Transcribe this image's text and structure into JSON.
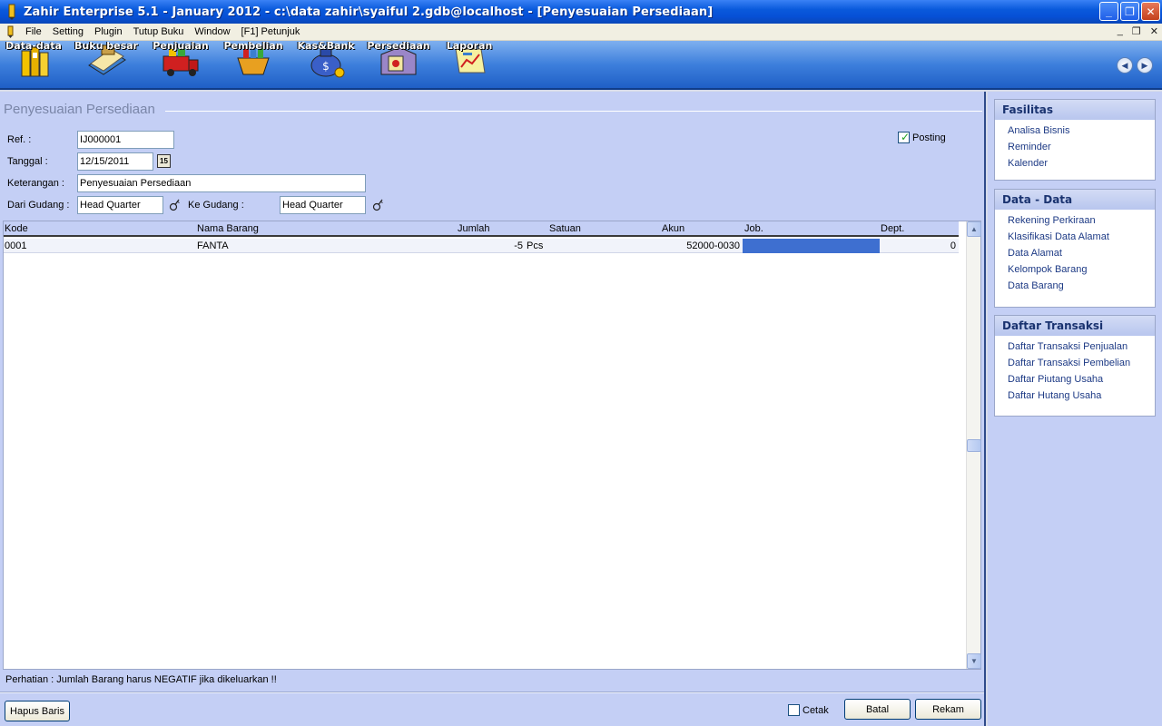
{
  "window": {
    "title": "Zahir Enterprise 5.1 - January 2012 - c:\\data zahir\\syaiful 2.gdb@localhost - [Penyesuaian Persediaan]",
    "min_glyph": "_",
    "max_glyph": "❐",
    "close_glyph": "✕"
  },
  "menu": {
    "items": [
      "File",
      "Setting",
      "Plugin",
      "Tutup Buku",
      "Window",
      "[F1] Petunjuk"
    ],
    "mdi_min": "_",
    "mdi_restore": "❐",
    "mdi_close": "✕"
  },
  "toolbar": {
    "buttons": [
      {
        "label": "Data-data",
        "icon": "binders-icon"
      },
      {
        "label": "Buku besar",
        "icon": "ledger-book-icon"
      },
      {
        "label": "Penjualan",
        "icon": "sales-truck-icon"
      },
      {
        "label": "Pembelian",
        "icon": "purchase-basket-icon"
      },
      {
        "label": "Kas&Bank",
        "icon": "money-bag-icon"
      },
      {
        "label": "Persediaan",
        "icon": "warehouse-box-icon"
      },
      {
        "label": "Laporan",
        "icon": "report-scroll-icon"
      }
    ],
    "nav_prev": "◀",
    "nav_next": "▶"
  },
  "form": {
    "title": "Penyesuaian Persediaan",
    "ref_label": "Ref. :",
    "ref_value": "IJ000001",
    "tanggal_label": "Tanggal :",
    "tanggal_value": "12/15/2011",
    "cal_label": "15",
    "keterangan_label": "Keterangan :",
    "keterangan_value": "Penyesuaian Persediaan",
    "dari_label": "Dari Gudang :",
    "dari_value": "Head Quarter",
    "ke_label": "Ke Gudang :",
    "ke_value": "Head Quarter",
    "posting_label": "Posting",
    "posting_checked": true
  },
  "grid": {
    "columns": [
      "Kode",
      "Nama Barang",
      "Jumlah",
      "Satuan",
      "Akun",
      "Job.",
      "Dept."
    ],
    "rows": [
      {
        "kode": "0001",
        "nama": "FANTA",
        "jumlah": "-5",
        "satuan": "Pcs",
        "akun": "52000-0030",
        "job": "",
        "dept": "0"
      }
    ],
    "scroll_up": "▲",
    "scroll_down": "▼"
  },
  "notice": "Perhatian : Jumlah Barang harus NEGATIF jika dikeluarkan !!",
  "actions": {
    "hapus_baris": "Hapus Baris",
    "cetak": "Cetak",
    "batal": "Batal",
    "rekam": "Rekam"
  },
  "sidebar": {
    "fasilitas": {
      "title": "Fasilitas",
      "items": [
        "Analisa Bisnis",
        "Reminder",
        "Kalender"
      ]
    },
    "data": {
      "title": "Data - Data",
      "items": [
        "Rekening Perkiraan",
        "Klasifikasi Data Alamat",
        "Data Alamat",
        "Kelompok Barang",
        "Data Barang"
      ]
    },
    "transaksi": {
      "title": "Daftar Transaksi",
      "items": [
        "Daftar Transaksi Penjualan",
        "Daftar Transaksi Pembelian",
        "Daftar Piutang Usaha",
        "Daftar Hutang Usaha"
      ]
    }
  },
  "colors": {
    "titlebar": "#0a5adc",
    "panel_bg": "#c4cff5",
    "selected_cell": "#3e6fd0",
    "link": "#1d3a85"
  }
}
